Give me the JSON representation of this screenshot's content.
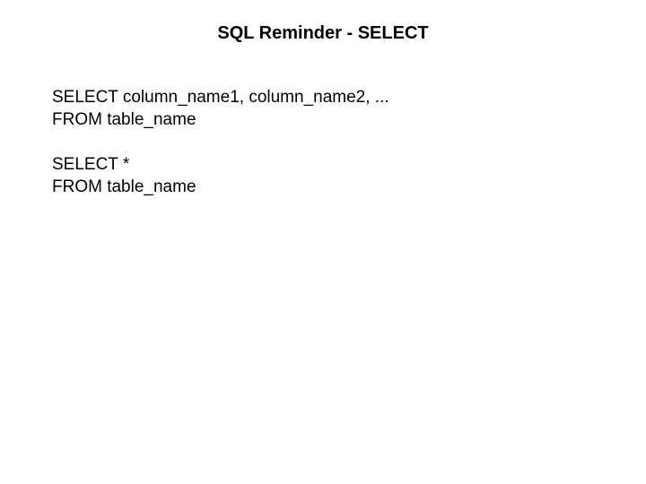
{
  "title": "SQL Reminder - SELECT",
  "block1": {
    "line1": "SELECT column_name1, column_name2, ...",
    "line2": "FROM table_name"
  },
  "block2": {
    "line1": "SELECT *",
    "line2": "FROM table_name"
  }
}
